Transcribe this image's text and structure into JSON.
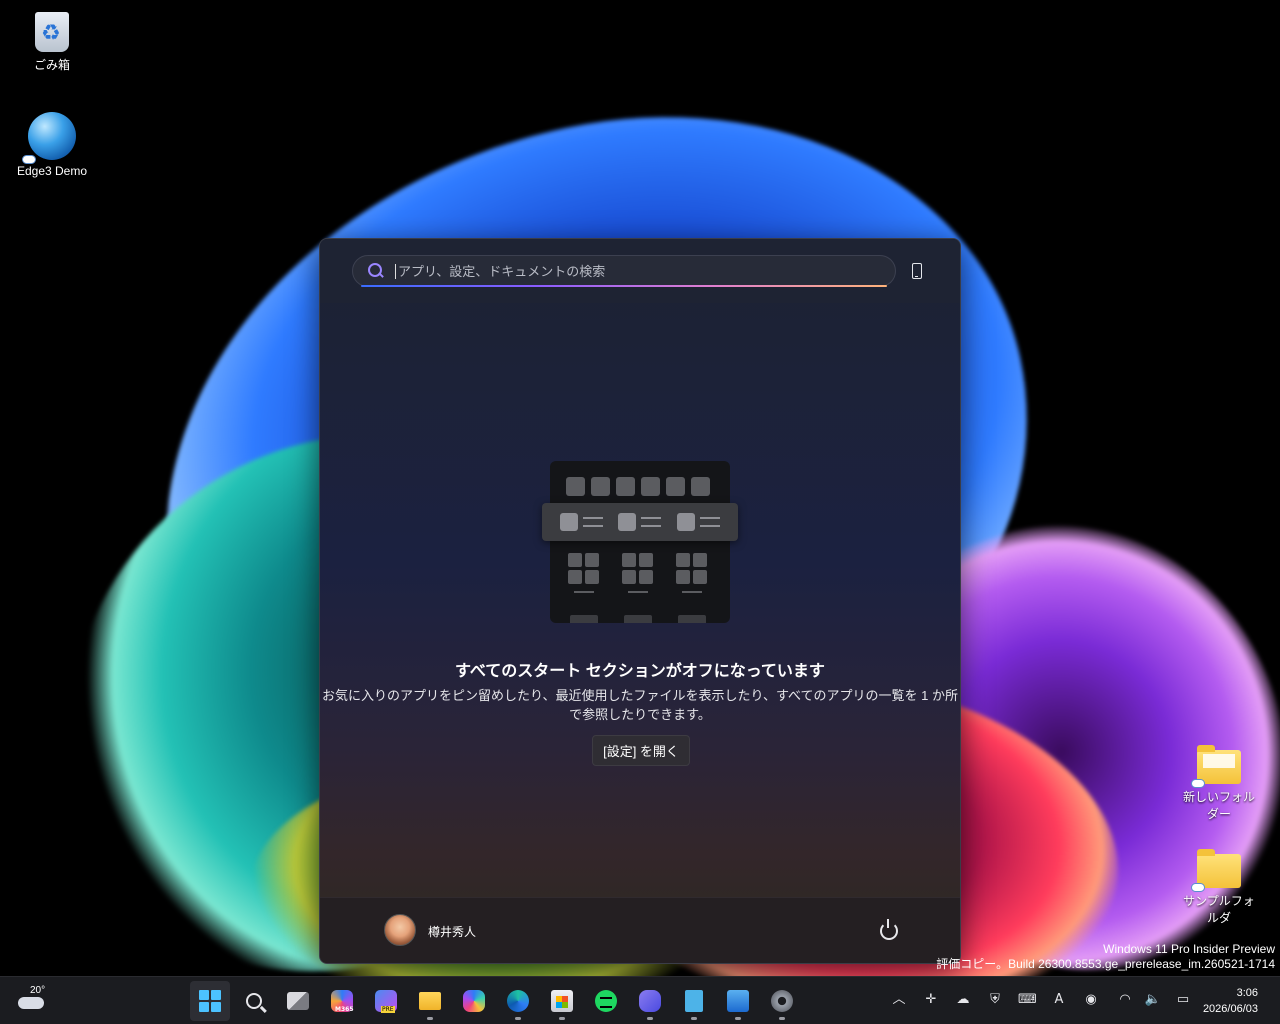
{
  "desktop": {
    "icons": [
      {
        "label": "ごみ箱"
      },
      {
        "label": "Edge3 Demo"
      },
      {
        "label": "新しいフォルダー"
      },
      {
        "label": "サンプルフォルダ"
      }
    ],
    "watermark_line1": "Windows 11 Pro Insider Preview",
    "watermark_line2": "評価コピー。Build 26300.8553.ge_prerelease_im.260521-1714"
  },
  "start_menu": {
    "search_placeholder": "アプリ、設定、ドキュメントの検索",
    "empty_title": "すべてのスタート セクションがオフになっています",
    "empty_description": "お気に入りのアプリをピン留めしたり、最近使用したファイルを表示したり、すべてのアプリの一覧を 1 か所で参照したりできます。",
    "settings_button": "[設定] を開く",
    "user_name": "樽井秀人"
  },
  "taskbar": {
    "weather_temp": "20°",
    "pinned": [
      {
        "name": "start",
        "icon": "windows-logo-icon",
        "active": true
      },
      {
        "name": "search",
        "icon": "search-icon"
      },
      {
        "name": "task-view",
        "icon": "task-view-icon"
      },
      {
        "name": "microsoft-365",
        "icon": "m365-icon",
        "badge": "M365"
      },
      {
        "name": "designer",
        "icon": "designer-icon",
        "badge": "PRE"
      },
      {
        "name": "file-explorer",
        "icon": "folder-icon",
        "running": true
      },
      {
        "name": "copilot",
        "icon": "copilot-icon"
      },
      {
        "name": "edge",
        "icon": "edge-icon",
        "running": true
      },
      {
        "name": "store",
        "icon": "store-icon",
        "running": true
      },
      {
        "name": "spotify",
        "icon": "spotify-icon"
      },
      {
        "name": "terminal",
        "icon": "terminal-icon",
        "running": true
      },
      {
        "name": "notepad",
        "icon": "notepad-icon",
        "running": true
      },
      {
        "name": "photos",
        "icon": "photos-icon",
        "running": true
      },
      {
        "name": "settings",
        "icon": "settings-icon",
        "running": true
      }
    ],
    "clock_time": "3:06",
    "clock_date": "2026/06/03",
    "ime_mode": "A"
  }
}
